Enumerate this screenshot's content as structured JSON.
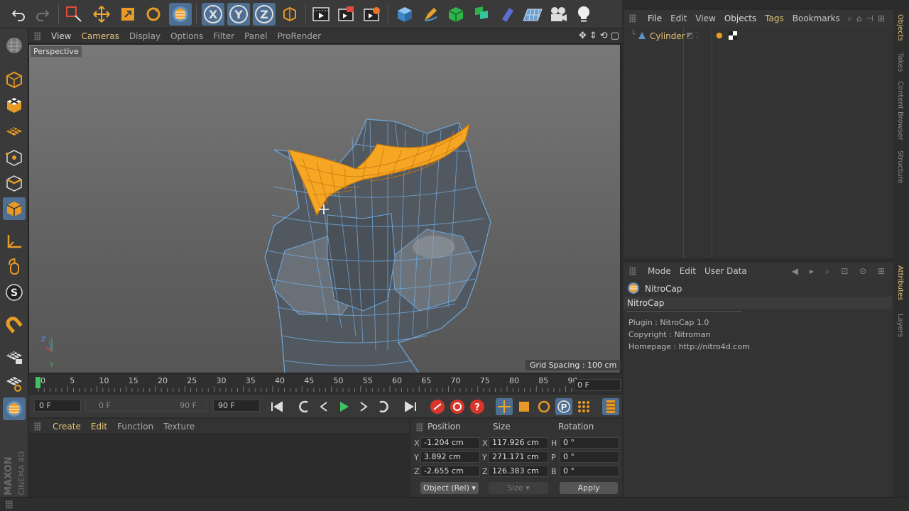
{
  "viewport": {
    "menu": [
      "View",
      "Cameras",
      "Display",
      "Options",
      "Filter",
      "Panel",
      "ProRender"
    ],
    "camera_label": "Perspective",
    "grid_spacing": "Grid Spacing : 100 cm",
    "axis_labels": {
      "y": "Y",
      "z": "Z"
    }
  },
  "timeline": {
    "ticks": [
      "0",
      "5",
      "10",
      "15",
      "20",
      "25",
      "30",
      "35",
      "40",
      "45",
      "50",
      "55",
      "60",
      "65",
      "70",
      "75",
      "80",
      "85",
      "90"
    ],
    "current_frame": "0 F",
    "start_frame": "0 F",
    "range_start": "0 F",
    "range_end": "90 F",
    "end_frame": "90 F"
  },
  "material_manager": {
    "menu": [
      "Create",
      "Edit",
      "Function",
      "Texture"
    ]
  },
  "coordinates": {
    "headers": {
      "position": "Position",
      "size": "Size",
      "rotation": "Rotation"
    },
    "rows": [
      {
        "pos_axis": "X",
        "pos": "-1.204 cm",
        "size_axis": "X",
        "size": "117.926 cm",
        "rot_axis": "H",
        "rot": "0 °"
      },
      {
        "pos_axis": "Y",
        "pos": "3.892 cm",
        "size_axis": "Y",
        "size": "271.171 cm",
        "rot_axis": "P",
        "rot": "0 °"
      },
      {
        "pos_axis": "Z",
        "pos": "-2.655 cm",
        "size_axis": "Z",
        "size": "126.383 cm",
        "rot_axis": "B",
        "rot": "0 °"
      }
    ],
    "mode_select": "Object (Rel)",
    "size_select": "Size",
    "apply_label": "Apply"
  },
  "object_manager": {
    "menu": [
      "File",
      "Edit",
      "View",
      "Objects",
      "Tags",
      "Bookmarks"
    ],
    "objects": [
      {
        "name": "Cylinder"
      }
    ]
  },
  "attributes": {
    "menu": [
      "Mode",
      "Edit",
      "User Data"
    ],
    "object_name": "NitroCap",
    "tab": "NitroCap",
    "info": [
      "Plugin : NitroCap 1.0",
      "Copyright : Nitroman",
      "Homepage : http://nitro4d.com"
    ]
  },
  "side_tabs": [
    "Objects",
    "Takes",
    "Content Browser",
    "Structure",
    "Attributes",
    "Layers"
  ],
  "branding": {
    "company": "MAXON",
    "product": "CINEMA 4D"
  },
  "colors": {
    "accent": "#e2c275",
    "selection": "#f5a623",
    "wire": "#6fa8dc",
    "active_button": "#4f6f92"
  }
}
